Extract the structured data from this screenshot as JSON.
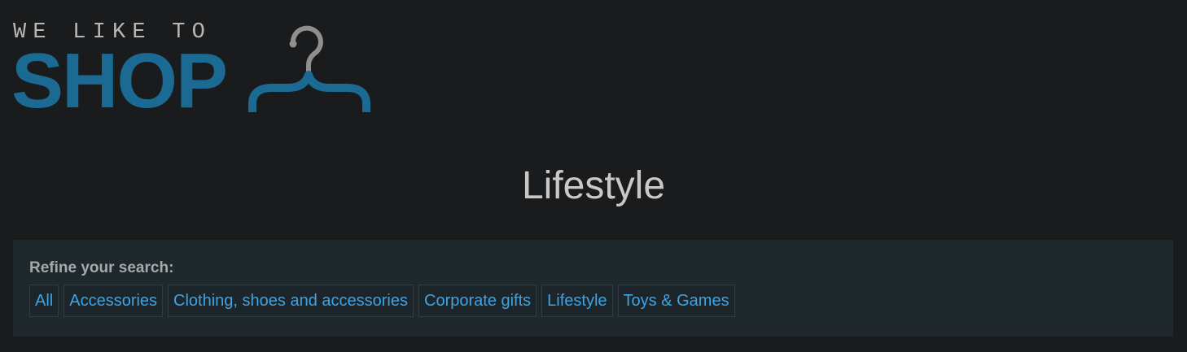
{
  "logo": {
    "tagline": "WE LIKE TO",
    "wordmark": "SHOP",
    "icon": "hanger-icon",
    "colors": {
      "tagline": "#b7b7b7",
      "wordmark": "#1a6a93",
      "hook": "#8f8f8f"
    }
  },
  "page": {
    "title": "Lifestyle"
  },
  "refine": {
    "label": "Refine your search:",
    "filters": [
      {
        "label": "All"
      },
      {
        "label": "Accessories"
      },
      {
        "label": "Clothing, shoes and accessories"
      },
      {
        "label": "Corporate gifts"
      },
      {
        "label": "Lifestyle"
      },
      {
        "label": "Toys & Games"
      }
    ]
  },
  "colors": {
    "background": "#1a1b1d",
    "panel": "#1e282d",
    "link": "#3fa3e4",
    "title": "#c8c8c8"
  }
}
